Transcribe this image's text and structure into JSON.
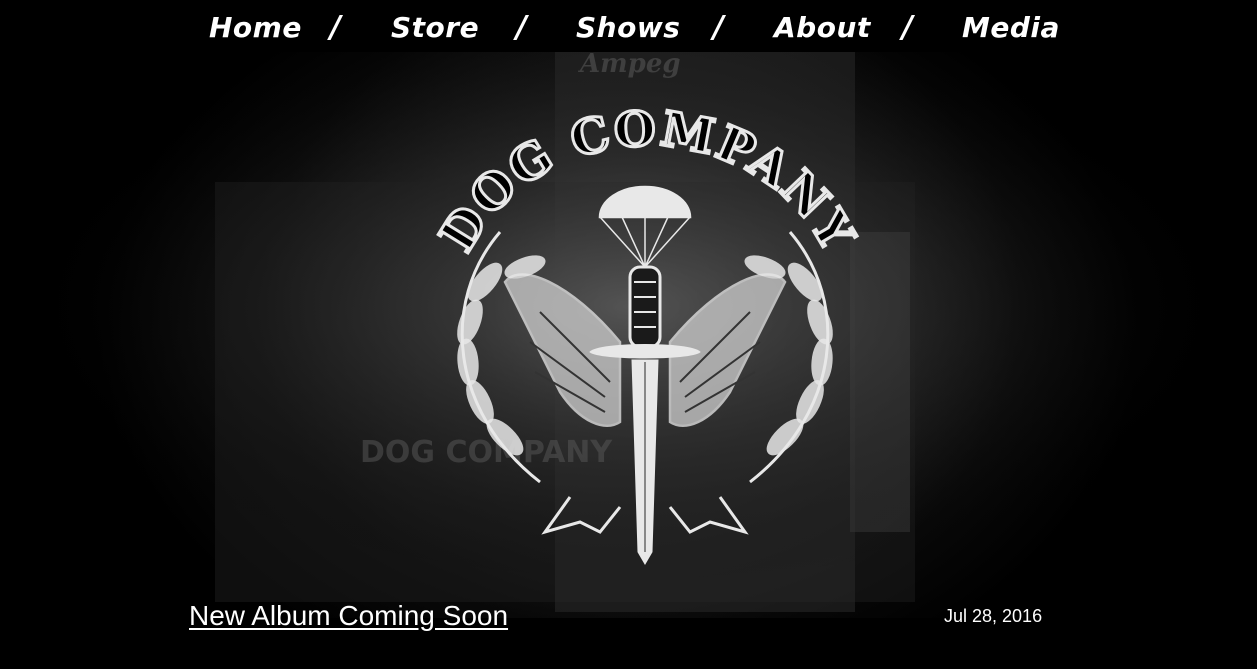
{
  "nav": {
    "items": [
      {
        "label": "Home"
      },
      {
        "label": "Store"
      },
      {
        "label": "Shows"
      },
      {
        "label": "About"
      },
      {
        "label": "Media"
      }
    ],
    "separator": "/"
  },
  "hero": {
    "logo_text": "DOG COMPANY",
    "background_text": "DOG COMPANY",
    "amp_brand_text": "Ampeg"
  },
  "post": {
    "title": "New Album Coming Soon",
    "date": "Jul 28, 2016"
  },
  "colors": {
    "background": "#000000",
    "text": "#ffffff",
    "emblem": "#e8e8e8"
  }
}
